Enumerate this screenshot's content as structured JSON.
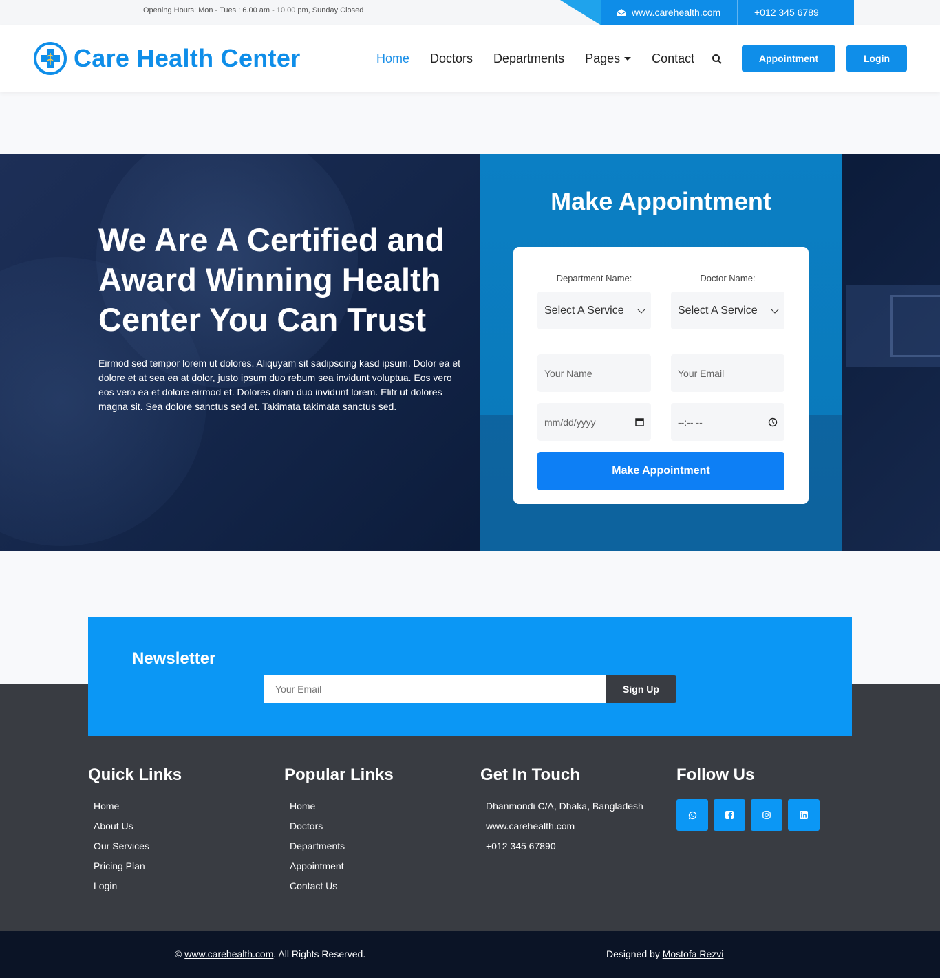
{
  "topbar": {
    "hours": "Opening Hours: Mon - Tues : 6.00 am - 10.00 pm, Sunday Closed",
    "website": "www.carehealth.com",
    "phone": "+012 345 6789"
  },
  "navbar": {
    "brand": "Care Health Center",
    "menu": [
      {
        "label": "Home",
        "active": true
      },
      {
        "label": "Doctors"
      },
      {
        "label": "Departments"
      },
      {
        "label": "Pages"
      },
      {
        "label": "Contact"
      }
    ],
    "appointment_label": "Appointment",
    "login_label": "Login"
  },
  "hero": {
    "title": "We Are A Certified and Award Winning Health Center You Can Trust",
    "description": "Eirmod sed tempor lorem ut dolores. Aliquyam sit sadipscing kasd ipsum. Dolor ea et dolore et at sea ea at dolor, justo ipsum duo rebum sea invidunt voluptua. Eos vero eos vero ea et dolore eirmod et. Dolores diam duo invidunt lorem. Elitr ut dolores magna sit. Sea dolore sanctus sed et. Takimata takimata sanctus sed."
  },
  "appointment": {
    "title": "Make Appointment",
    "department_label": "Department Name:",
    "doctor_label": "Doctor Name:",
    "department_value": "Select A Service",
    "doctor_value": "Select A Service",
    "name_placeholder": "Your Name",
    "email_placeholder": "Your Email",
    "date_placeholder": "mm/dd/yyyy",
    "time_placeholder": "--:-- --",
    "submit_label": "Make Appointment"
  },
  "newsletter": {
    "title": "Newsletter",
    "email_placeholder": "Your Email",
    "signup_label": "Sign Up"
  },
  "footer": {
    "quick_links": {
      "title": "Quick Links",
      "items": [
        "Home",
        "About Us",
        "Our Services",
        "Pricing Plan",
        "Login"
      ]
    },
    "popular_links": {
      "title": "Popular Links",
      "items": [
        "Home",
        "Doctors",
        "Departments",
        "Appointment",
        "Contact Us"
      ]
    },
    "get_in_touch": {
      "title": "Get In Touch",
      "address": "Dhanmondi C/A, Dhaka, Bangladesh",
      "website": "www.carehealth.com",
      "phone": "+012 345 67890"
    },
    "follow_us": {
      "title": "Follow Us",
      "icons": [
        "whatsapp-icon",
        "facebook-icon",
        "instagram-icon",
        "linkedin-icon"
      ]
    }
  },
  "copyright": {
    "symbol": "©",
    "site_link": "www.carehealth.com",
    "rights": ". All Rights Reserved.",
    "designed_by": "Designed by",
    "designer": "Mostofa Rezvi"
  },
  "colors": {
    "primary": "#0f8ee9",
    "newsletter_bg": "#0b97f5",
    "footer_bg": "#393c42",
    "copyright_bg": "#0b1426",
    "hero_bg": "#14264a",
    "appointment_panel": "#0b7fc4",
    "submit_button": "#0d7ff5"
  }
}
